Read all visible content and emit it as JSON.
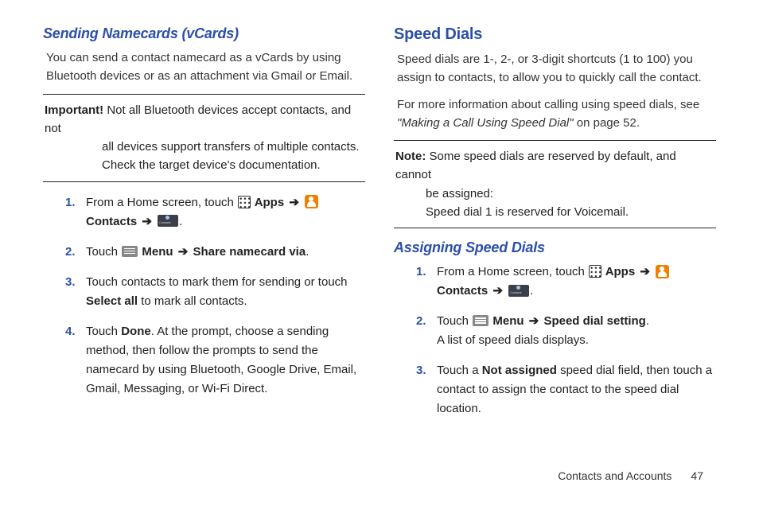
{
  "left": {
    "heading": "Sending Namecards (vCards)",
    "intro": "You can send a contact namecard as a vCards by using Bluetooth devices or as an attachment via Gmail or Email.",
    "important_label": "Important!",
    "important_first": " Not all Bluetooth devices accept contacts, and not",
    "important_rest": "all devices support transfers of multiple contacts. Check the target device's documentation.",
    "steps": {
      "n1": "1.",
      "s1a": "From a Home screen, touch ",
      "s1_apps": " Apps ",
      "s1_contacts": " Contacts ",
      "n2": "2.",
      "s2a": "Touch ",
      "s2_menu": " Menu ",
      "s2_share": " Share namecard via",
      "n3": "3.",
      "s3a": "Touch contacts to mark them for sending or touch ",
      "s3_selectall": "Select all",
      "s3b": " to mark all contacts.",
      "n4": "4.",
      "s4a": "Touch ",
      "s4_done": "Done",
      "s4b": ". At the prompt, choose a sending method, then follow the prompts to send the namecard by using Bluetooth, Google Drive, Email, Gmail, Messaging, or Wi-Fi Direct."
    }
  },
  "right": {
    "heading": "Speed Dials",
    "intro": "Speed dials are 1-, 2-, or 3-digit shortcuts (1 to 100) you assign to contacts, to allow you to quickly call the contact.",
    "ref_a": "For more information about calling using speed dials, see ",
    "ref_i": "\"Making a Call Using Speed Dial\"",
    "ref_b": " on page 52.",
    "note_label": "Note:",
    "note_first": " Some speed dials are reserved by default, and cannot",
    "note_rest_a": "be assigned:",
    "note_rest_b": "Speed dial 1 is reserved for Voicemail.",
    "sub_heading": "Assigning Speed Dials",
    "steps": {
      "n1": "1.",
      "s1a": "From a Home screen, touch ",
      "s1_apps": " Apps ",
      "s1_contacts": " Contacts ",
      "n2": "2.",
      "s2a": "Touch ",
      "s2_menu": " Menu ",
      "s2_speed": " Speed dial setting",
      "s2b": "A list of speed dials displays.",
      "n3": "3.",
      "s3a": "Touch a ",
      "s3_na": "Not assigned",
      "s3b": " speed dial field, then touch a contact to assign the contact to the speed dial location."
    }
  },
  "footer": {
    "section": "Contacts and Accounts",
    "page": "47"
  },
  "glyphs": {
    "arrow": "➔",
    "period": "."
  }
}
